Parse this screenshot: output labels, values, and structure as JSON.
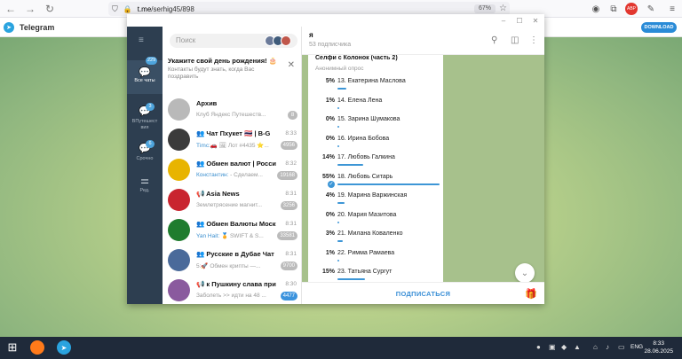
{
  "browser": {
    "url_host": "t.me",
    "url_path": "/serhig45/898",
    "zoom": "67%"
  },
  "tg_header": {
    "brand": "Telegram",
    "download": "DOWNLOAD"
  },
  "sidebar": {
    "items": [
      {
        "label": "Все чаты",
        "badge": "229",
        "icon": "chat-bubbles-icon"
      },
      {
        "label": "ВПутешест вия",
        "badge": "3",
        "icon": "chat-bubbles-icon"
      },
      {
        "label": "Срочно",
        "badge": "6",
        "icon": "chat-bubbles-icon"
      },
      {
        "label": "Ред.",
        "badge": "",
        "icon": "sliders-icon"
      }
    ]
  },
  "chatlist": {
    "search_placeholder": "Поиск",
    "birthday": {
      "title": "Укажите свой день рождения! 🎂",
      "text": "Контакты будут знать, когда Вас поздравить"
    },
    "chats": [
      {
        "name": "Архив",
        "time": "",
        "sender": "",
        "msg": "Клуб Яндекс Путешеств...",
        "badge": "8",
        "badge_blue": false,
        "avatar": "#b9b9b9"
      },
      {
        "name": "👥 Чат Пхукет 🇹🇭 | B-G",
        "time": "8:33",
        "sender": "Тimс:🚗 ",
        "msg": "🖼 Лот #4435  ⭐...",
        "badge": "4956",
        "badge_blue": false,
        "avatar": "#3b3b3b"
      },
      {
        "name": "👥 Обмен валют | Росси...",
        "time": "8:32",
        "sender": "Константин: ",
        "msg": "- Сделаем...",
        "badge": "19168",
        "badge_blue": false,
        "avatar": "#e8b400"
      },
      {
        "name": "📢 Asia News",
        "time": "8:31",
        "sender": "",
        "msg": "Землетрясение магнит...",
        "badge": "3256",
        "badge_blue": false,
        "avatar": "#c9242f"
      },
      {
        "name": "👥 Обмен Валюты Моск...",
        "time": "8:31",
        "sender": "Yan Hait: ",
        "msg": "🏅 SWIFT & S...",
        "badge": "33581",
        "badge_blue": false,
        "avatar": "#1f7c2e"
      },
      {
        "name": "👥 Русские в Дубае Чат ...",
        "time": "8:31",
        "sender": "",
        "msg": "5:🚀 Обмен крипты —...",
        "badge": "9700",
        "badge_blue": false,
        "avatar": "#4a6a9a"
      },
      {
        "name": "📢 к Пушкину слава при...",
        "time": "8:30",
        "sender": "",
        "msg": "Заболеть >> идти на 48 ...",
        "badge": "4477",
        "badge_blue": true,
        "avatar": "#8a5a9e"
      }
    ]
  },
  "chat": {
    "title": "я",
    "subtitle": "53 подписчика",
    "poll": {
      "question": "Селфи с Колонок (часть 2)",
      "type": "Анонимный опрос",
      "options": [
        {
          "pct": "5%",
          "label": "13. Екатерина Маслова",
          "value": 5,
          "selected": false
        },
        {
          "pct": "1%",
          "label": "14. Елена Лена",
          "value": 1,
          "selected": false
        },
        {
          "pct": "0%",
          "label": "15. Зарина Шумакова",
          "value": 0,
          "selected": false
        },
        {
          "pct": "0%",
          "label": "16. Ирина Бобова",
          "value": 0,
          "selected": false
        },
        {
          "pct": "14%",
          "label": "17. Любовь Галкина",
          "value": 14,
          "selected": false
        },
        {
          "pct": "55%",
          "label": "18. Любовь Ситарь",
          "value": 55,
          "selected": true
        },
        {
          "pct": "4%",
          "label": "19. Марина Варжинская",
          "value": 4,
          "selected": false
        },
        {
          "pct": "0%",
          "label": "20. Мария Мазитова",
          "value": 0,
          "selected": false
        },
        {
          "pct": "3%",
          "label": "21. Милана Коваленко",
          "value": 3,
          "selected": false
        },
        {
          "pct": "1%",
          "label": "22. Римма Рамаева",
          "value": 1,
          "selected": false
        },
        {
          "pct": "15%",
          "label": "23. Татьяна Сургут",
          "value": 15,
          "selected": false
        }
      ]
    },
    "subscribe": "ПОДПИСАТЬСЯ"
  },
  "taskbar": {
    "time": "8:33",
    "date": "28.06.2025",
    "lang": "ENG"
  }
}
